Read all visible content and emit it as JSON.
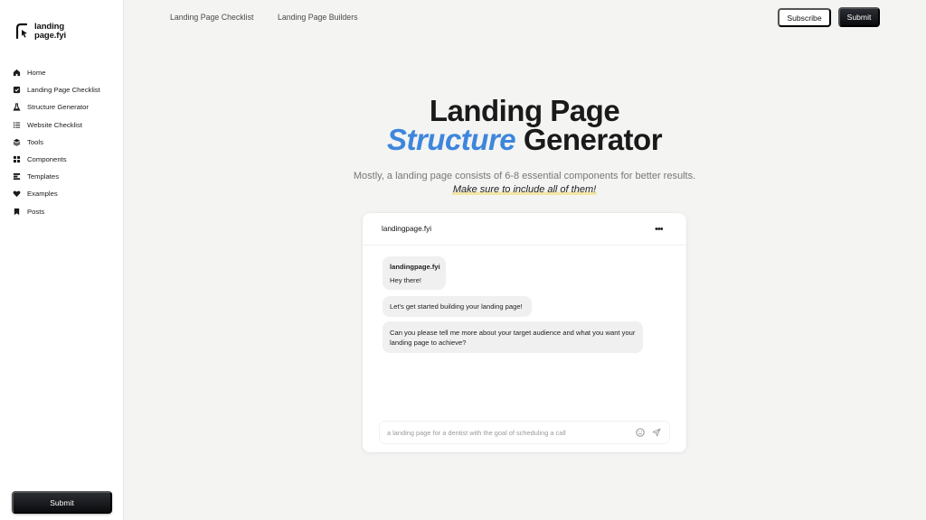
{
  "brand": {
    "line1": "landing",
    "line2": "page.fyi"
  },
  "sidebar": {
    "items": [
      {
        "label": "Home",
        "icon": "home-icon"
      },
      {
        "label": "Landing Page Checklist",
        "icon": "checkbox-icon"
      },
      {
        "label": "Structure Generator",
        "icon": "flask-icon"
      },
      {
        "label": "Website Checklist",
        "icon": "list-icon"
      },
      {
        "label": "Tools",
        "icon": "layers-icon"
      },
      {
        "label": "Components",
        "icon": "grid-icon"
      },
      {
        "label": "Templates",
        "icon": "template-icon"
      },
      {
        "label": "Examples",
        "icon": "heart-icon"
      },
      {
        "label": "Posts",
        "icon": "bookmark-icon"
      }
    ],
    "submit_label": "Submit"
  },
  "topnav": {
    "links": [
      "Landing Page Checklist",
      "Landing Page Builders"
    ],
    "subscribe_label": "Subscribe",
    "submit_label": "Submit"
  },
  "hero": {
    "line1": "Landing Page",
    "accent": "Structure",
    "line2_rest": " Generator",
    "subtitle": "Mostly, a landing page consists of 6-8 essential components for better results.",
    "highlight": "Make sure to include all of them!"
  },
  "chat": {
    "title": "landingpage.fyi",
    "more_icon": "more-dots-icon",
    "messages": [
      {
        "sender": "landingpage.fyi",
        "text": "Hey there!"
      },
      {
        "text": "Let's get started building your landing page!"
      },
      {
        "text": "Can you please tell me more about your target audience and what you want your landing page to achieve?"
      }
    ],
    "input_placeholder": "a landing page for a dentist with the goal of scheduling a call",
    "emoji_icon": "emoji-icon",
    "send_icon": "send-icon"
  },
  "colors": {
    "accent": "#3e86dc",
    "dark_button": "#0b0c0e",
    "background": "#f4f4f3",
    "highlight": "#f3e6a8"
  }
}
